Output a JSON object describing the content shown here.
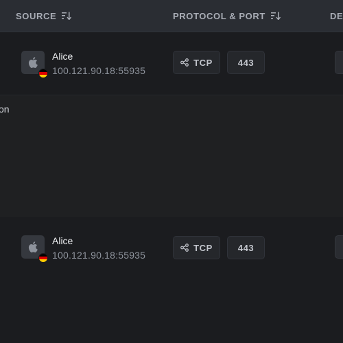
{
  "table": {
    "columns": [
      {
        "label": "SOURCE"
      },
      {
        "label": "PROTOCOL & PORT"
      },
      {
        "label": "DES"
      }
    ],
    "rows": [
      {
        "source_name": "Alice",
        "source_address": "100.121.90.18:55935",
        "os_icon": "apple-icon",
        "country_flag": "germany-flag-icon",
        "protocol": "TCP",
        "port": "443"
      },
      {
        "source_name": "Alice",
        "source_address": "100.121.90.18:55935",
        "os_icon": "apple-icon",
        "country_flag": "germany-flag-icon",
        "protocol": "TCP",
        "port": "443"
      }
    ],
    "expanded_detail_text": "on"
  },
  "colors": {
    "header_bg": "#2a2d33",
    "row_bg": "#1b1c1f",
    "detail_bg": "#1f2022"
  }
}
